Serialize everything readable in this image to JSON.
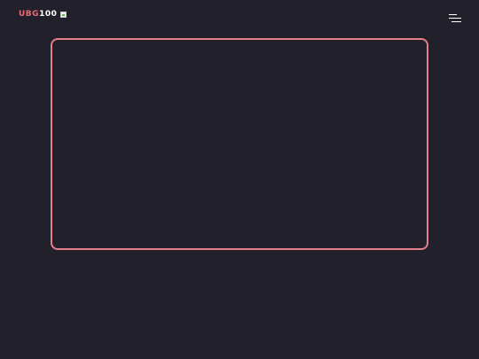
{
  "header": {
    "logo": {
      "accent_text": "UBG",
      "plain_text": "100",
      "image_icon": "broken-image-icon"
    },
    "menu_icon": "hamburger-menu-icon"
  },
  "colors": {
    "background": "#22212b",
    "accent": "#e96b78",
    "frame_border": "#e67f89",
    "logo_plain": "#ffffff"
  }
}
